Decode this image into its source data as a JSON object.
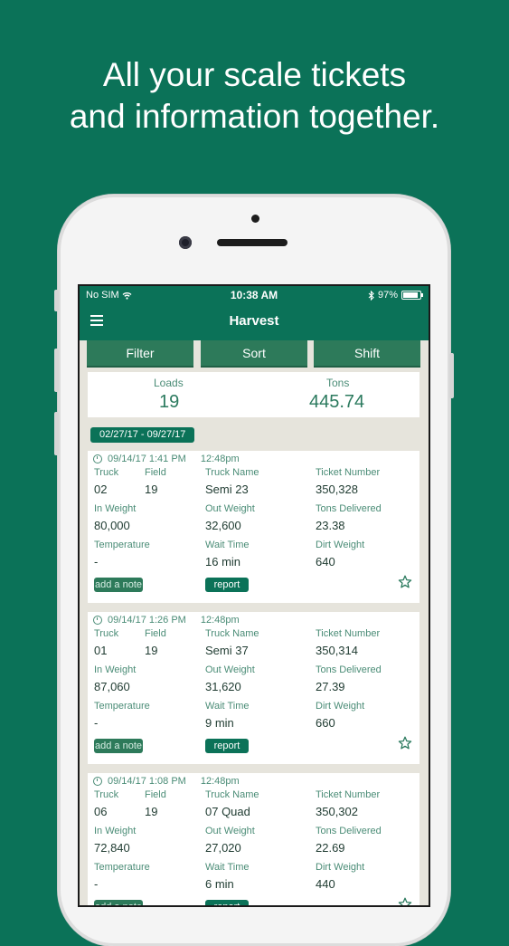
{
  "headline": {
    "line1": "All your scale tickets",
    "line2": "and information together."
  },
  "status_bar": {
    "carrier": "No SIM",
    "time": "10:38 AM",
    "battery": "97%"
  },
  "nav": {
    "title": "Harvest"
  },
  "toolbar": {
    "filter": "Filter",
    "sort": "Sort",
    "shift": "Shift"
  },
  "totals": {
    "loads_label": "Loads",
    "loads_value": "19",
    "tons_label": "Tons",
    "tons_value": "445.74"
  },
  "date_range": "02/27/17 - 09/27/17",
  "labels": {
    "truck": "Truck",
    "field": "Field",
    "truck_name": "Truck Name",
    "ticket_number": "Ticket Number",
    "in_weight": "In Weight",
    "out_weight": "Out Weight",
    "tons_delivered": "Tons Delivered",
    "temperature": "Temperature",
    "wait_time": "Wait Time",
    "dirt_weight": "Dirt Weight",
    "add_note": "add a note",
    "report": "report"
  },
  "tickets": [
    {
      "datetime": "09/14/17  1:41 PM",
      "time2": "12:48pm",
      "truck": "02",
      "field": "19",
      "truck_name": "Semi 23",
      "ticket_number": "350,328",
      "in_weight": "80,000",
      "out_weight": "32,600",
      "tons_delivered": "23.38",
      "temperature": "-",
      "wait_time": "16 min",
      "dirt_weight": "640"
    },
    {
      "datetime": "09/14/17  1:26 PM",
      "time2": "12:48pm",
      "truck": "01",
      "field": "19",
      "truck_name": "Semi 37",
      "ticket_number": "350,314",
      "in_weight": "87,060",
      "out_weight": "31,620",
      "tons_delivered": "27.39",
      "temperature": "-",
      "wait_time": "9 min",
      "dirt_weight": "660"
    },
    {
      "datetime": "09/14/17  1:08 PM",
      "time2": "12:48pm",
      "truck": "06",
      "field": "19",
      "truck_name": "07 Quad",
      "ticket_number": "350,302",
      "in_weight": "72,840",
      "out_weight": "27,020",
      "tons_delivered": "22.69",
      "temperature": "-",
      "wait_time": "6 min",
      "dirt_weight": "440"
    }
  ],
  "colors": {
    "brand_green": "#0b7258",
    "button_green": "#2d7a5a",
    "label_green": "#4a8c76"
  }
}
